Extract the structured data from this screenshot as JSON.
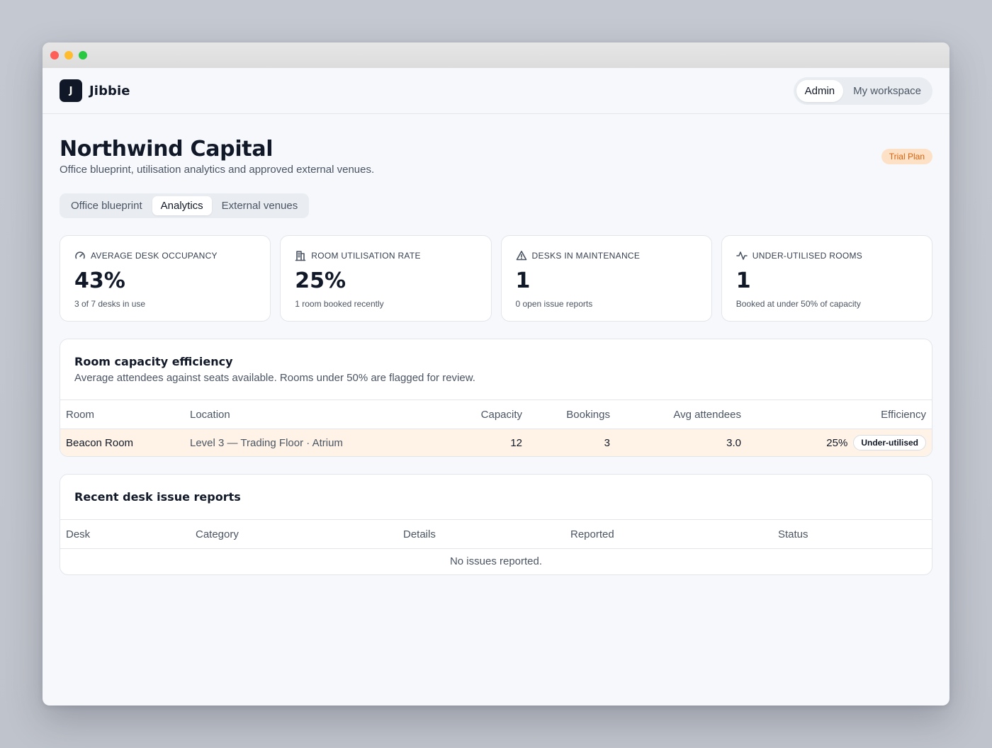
{
  "brand": {
    "initial": "J",
    "name": "Jibbie"
  },
  "mode_switch": [
    {
      "label": "Admin",
      "active": true
    },
    {
      "label": "My workspace",
      "active": false
    }
  ],
  "page": {
    "title": "Northwind Capital",
    "subtitle": "Office blueprint, utilisation analytics and approved external venues.",
    "plan_badge": "Trial Plan"
  },
  "tabs": [
    {
      "label": "Office blueprint",
      "active": false
    },
    {
      "label": "Analytics",
      "active": true
    },
    {
      "label": "External venues",
      "active": false
    }
  ],
  "kpis": [
    {
      "icon": "gauge-icon",
      "label": "AVERAGE DESK OCCUPANCY",
      "value": "43%",
      "sub": "3 of 7 desks in use"
    },
    {
      "icon": "building-icon",
      "label": "ROOM UTILISATION RATE",
      "value": "25%",
      "sub": "1 room booked recently"
    },
    {
      "icon": "warning-icon",
      "label": "DESKS IN MAINTENANCE",
      "value": "1",
      "sub": "0 open issue reports"
    },
    {
      "icon": "activity-icon",
      "label": "UNDER-UTILISED ROOMS",
      "value": "1",
      "sub": "Booked at under 50% of capacity"
    }
  ],
  "efficiency": {
    "title": "Room capacity efficiency",
    "subtitle": "Average attendees against seats available. Rooms under 50% are flagged for review.",
    "columns": [
      "Room",
      "Location",
      "Capacity",
      "Bookings",
      "Avg attendees",
      "Efficiency"
    ],
    "rows": [
      {
        "room": "Beacon Room",
        "location": "Level 3 — Trading Floor · Atrium",
        "capacity": "12",
        "bookings": "3",
        "avg": "3.0",
        "efficiency": "25%",
        "flag": "Under-utilised"
      }
    ]
  },
  "issues": {
    "title": "Recent desk issue reports",
    "columns": [
      "Desk",
      "Category",
      "Details",
      "Reported",
      "Status"
    ],
    "empty": "No issues reported."
  }
}
